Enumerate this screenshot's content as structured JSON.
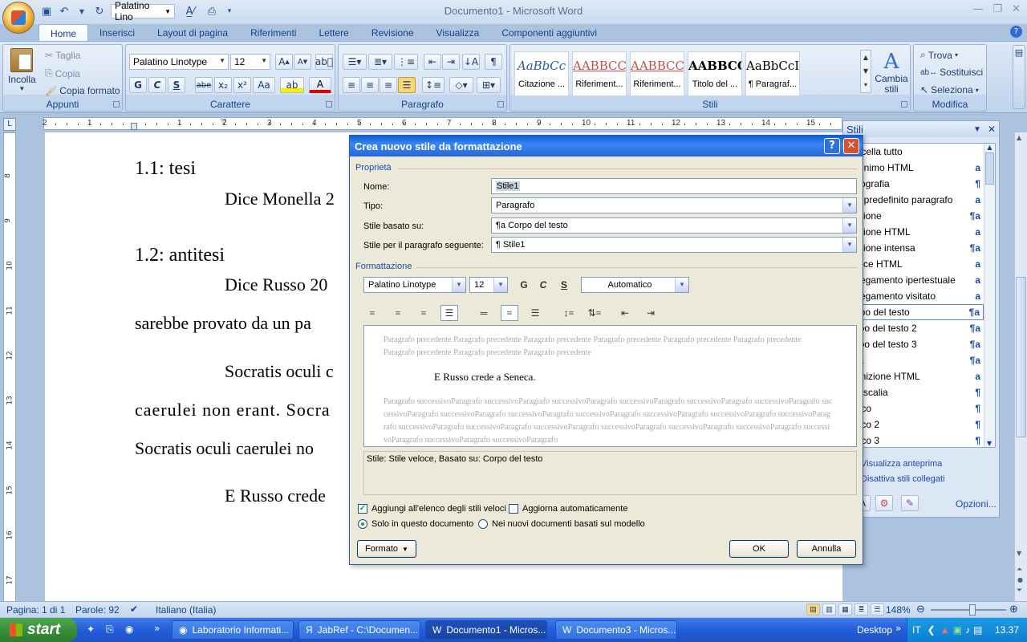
{
  "window": {
    "title": "Documento1 - Microsoft Word"
  },
  "qat": {
    "font": "Palatino Lino"
  },
  "tabs": [
    "Home",
    "Inserisci",
    "Layout di pagina",
    "Riferimenti",
    "Lettere",
    "Revisione",
    "Visualizza",
    "Componenti aggiuntivi"
  ],
  "ribbon": {
    "clipboard": {
      "label": "Appunti",
      "paste": "Incolla",
      "cut": "Taglia",
      "copy": "Copia",
      "format_painter": "Copia formato"
    },
    "font": {
      "label": "Carattere",
      "name": "Palatino Linotype",
      "size": "12",
      "bold": "G",
      "italic": "C",
      "underline": "S",
      "strike": "abe",
      "sub": "x₂",
      "sup": "x²",
      "case": "Aa"
    },
    "paragraph": {
      "label": "Paragrafo"
    },
    "styles": {
      "label": "Stili",
      "tiles": [
        {
          "preview": "AaBbCc",
          "name": "Citazione ...",
          "color": "#2c5aa0"
        },
        {
          "preview": "AABBCC",
          "name": "Riferiment...",
          "color": "#c0504d"
        },
        {
          "preview": "AABBCC",
          "name": "Riferiment...",
          "color": "#c0504d"
        },
        {
          "preview": "AABBCC",
          "name": "Titolo del ...",
          "color": "#000000"
        },
        {
          "preview": "AaBbCcI",
          "name": "¶ Paragraf...",
          "color": "#000000"
        }
      ],
      "change": "Cambia stili"
    },
    "editing": {
      "label": "Modifica",
      "find": "Trova",
      "replace": "Sostituisci",
      "select": "Seleziona"
    }
  },
  "ruler": {
    "marks": [
      "2",
      "1",
      "1",
      "2",
      "3",
      "4",
      "5",
      "6",
      "7",
      "8",
      "9",
      "10",
      "11",
      "12",
      "13",
      "14",
      "15"
    ]
  },
  "document": {
    "h1": "1.1: tesi",
    "p1": "Dice Monella 2",
    "h2": "1.2: antitesi",
    "p2": "Dice Russo 20",
    "p3": "sarebbe provato da un pa",
    "p4": "Socratis oculi c",
    "p5": "caerulei non erant. Socra",
    "p6": "Socratis oculi caerulei no",
    "p7": "E Russo crede"
  },
  "styles_pane": {
    "title": "Stili",
    "items": [
      {
        "name": "ancella tutto",
        "mark": ""
      },
      {
        "name": "cronimo HTML",
        "mark": "a"
      },
      {
        "name": "bliografia",
        "mark": "¶"
      },
      {
        "name": "ar. predefinito paragrafo",
        "mark": "a"
      },
      {
        "name": "tazione",
        "mark": "¶a"
      },
      {
        "name": "tazione HTML",
        "mark": "a"
      },
      {
        "name": "tazione intensa",
        "mark": "¶a"
      },
      {
        "name": "odice HTML",
        "mark": "a"
      },
      {
        "name": "ollegamento ipertestuale",
        "mark": "a"
      },
      {
        "name": "ollegamento visitato",
        "mark": "a"
      },
      {
        "name": "orpo del testo",
        "mark": "¶a"
      },
      {
        "name": "orpo del testo 2",
        "mark": "¶a"
      },
      {
        "name": "orpo del testo 3",
        "mark": "¶a"
      },
      {
        "name": "ata",
        "mark": "¶a"
      },
      {
        "name": "efinizione HTML",
        "mark": "a"
      },
      {
        "name": "idascalia",
        "mark": "¶"
      },
      {
        "name": "enco",
        "mark": "¶"
      },
      {
        "name": "enco 2",
        "mark": "¶"
      },
      {
        "name": "enco 3",
        "mark": "¶"
      }
    ],
    "selected_index": 10,
    "show_preview": "Visualizza anteprima",
    "disable_linked": "Disattiva stili collegati",
    "options": "Opzioni..."
  },
  "dialog": {
    "title": "Crea nuovo stile da formattazione",
    "properties": "Proprietà",
    "name_label": "Nome:",
    "name_value": "Stile1",
    "type_label": "Tipo:",
    "type_value": "Paragrafo",
    "based_label": "Stile basato su:",
    "based_value": "¶a Corpo del testo",
    "next_label": "Stile per il paragrafo seguente:",
    "next_value": "¶ Stile1",
    "formatting": "Formattazione",
    "font": "Palatino Linotype",
    "size": "12",
    "bold": "G",
    "italic": "C",
    "underline": "S",
    "color": "Automatico",
    "preview_prev": "Paragrafo precedente Paragrafo precedente Paragrafo precedente Paragrafo precedente Paragrafo precedente Paragrafo precedente Paragrafo precedente Paragrafo precedente Paragrafo precedente",
    "preview_sample": "E Russo crede a Seneca.",
    "preview_next": "Paragrafo successivoParagrafo successivoParagrafo successivoParagrafo successivoParagrafo successivoParagrafo successivoParagrafo successivoParagrafo successivoParagrafo successivoParagrafo successivoParagrafo successivoParagrafo successivoParagrafo successivoParagrafo successivoParagrafo successivoParagrafo successivoParagrafo successivoParagrafo successivoParagrafo successivoParagrafo successivoParagrafo successivoParagrafo successivoParagrafo",
    "description": "Stile: Stile veloce, Basato su: Corpo del testo",
    "add_quick": "Aggiungi all'elenco degli stili veloci",
    "auto_update": "Aggiorna automaticamente",
    "only_doc": "Solo in questo documento",
    "new_docs": "Nei nuovi documenti basati sul modello",
    "format_btn": "Formato",
    "ok": "OK",
    "cancel": "Annulla"
  },
  "statusbar": {
    "page": "Pagina: 1 di 1",
    "words": "Parole: 92",
    "lang": "Italiano (Italia)",
    "zoom": "148%"
  },
  "taskbar": {
    "start": "start",
    "tasks": [
      "Laboratorio Informati...",
      "JabRef - C:\\Documen...",
      "Documento1 - Micros...",
      "Documento3 - Micros..."
    ],
    "desktop": "Desktop",
    "lang": "IT",
    "time": "13.37"
  }
}
